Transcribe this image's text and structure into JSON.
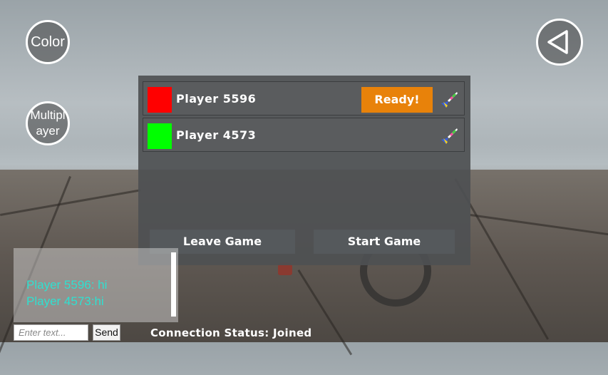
{
  "hud": {
    "color_label": "Color",
    "multiplayer_label": "Multiplayer",
    "back_icon": "back-triangle-icon"
  },
  "lobby": {
    "players": [
      {
        "name": "Player 5596",
        "color": "#ff0000",
        "ready_label": "Ready!",
        "brush_icon": "paintbrush-icon"
      },
      {
        "name": "Player 4573",
        "color": "#00ff00",
        "brush_icon": "paintbrush-icon"
      }
    ],
    "leave_label": "Leave Game",
    "start_label": "Start Game"
  },
  "chat": {
    "messages": [
      "Player 5596: hi",
      "Player 4573:hi"
    ],
    "input_placeholder": "Enter text...",
    "send_label": "Send"
  },
  "status": "Connection Status: Joined",
  "colors": {
    "ready_button": "#e8820a",
    "chat_text": "#2fe0d0"
  }
}
